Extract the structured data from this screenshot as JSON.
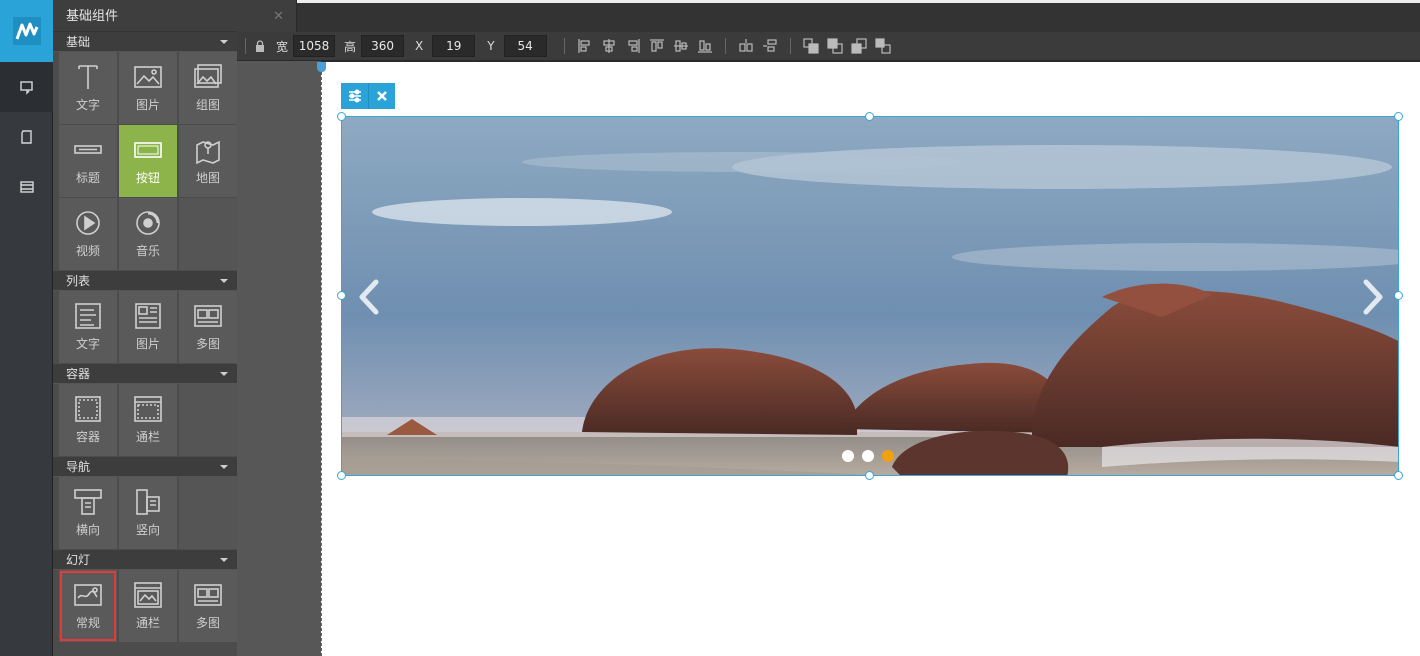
{
  "panel": {
    "title": "基础组件",
    "sections": [
      {
        "title": "基础",
        "items": [
          {
            "label": "文字",
            "icon": "text-icon"
          },
          {
            "label": "图片",
            "icon": "image-icon"
          },
          {
            "label": "组图",
            "icon": "gallery-icon"
          },
          {
            "label": "标题",
            "icon": "title-icon"
          },
          {
            "label": "按钮",
            "icon": "button-icon",
            "selected": true
          },
          {
            "label": "地图",
            "icon": "map-pin-icon"
          },
          {
            "label": "视频",
            "icon": "video-icon"
          },
          {
            "label": "音乐",
            "icon": "music-icon"
          }
        ]
      },
      {
        "title": "列表",
        "items": [
          {
            "label": "文字",
            "icon": "text-list-icon"
          },
          {
            "label": "图片",
            "icon": "image-list-icon"
          },
          {
            "label": "多图",
            "icon": "multi-image-icon"
          }
        ]
      },
      {
        "title": "容器",
        "items": [
          {
            "label": "容器",
            "icon": "container-icon"
          },
          {
            "label": "通栏",
            "icon": "fullwidth-icon"
          }
        ]
      },
      {
        "title": "导航",
        "items": [
          {
            "label": "横向",
            "icon": "horizontal-nav-icon"
          },
          {
            "label": "竖向",
            "icon": "vertical-nav-icon"
          }
        ]
      },
      {
        "title": "幻灯",
        "items": [
          {
            "label": "常规",
            "icon": "slide-regular-icon",
            "highlighted": true
          },
          {
            "label": "通栏",
            "icon": "slide-fullwidth-icon"
          },
          {
            "label": "多图",
            "icon": "slide-multi-icon"
          }
        ]
      }
    ]
  },
  "toolbar": {
    "width_label": "宽",
    "width_value": "1058",
    "height_label": "高",
    "height_value": "360",
    "x_label": "X",
    "x_value": "19",
    "y_label": "Y",
    "y_value": "54"
  },
  "slider": {
    "total_dots": 3,
    "active_dot": 2
  },
  "colors": {
    "accent": "#2aa4d8",
    "selected_item": "#8cb44b",
    "highlight_border": "#e23a3a",
    "active_dot": "#f0a10f"
  }
}
